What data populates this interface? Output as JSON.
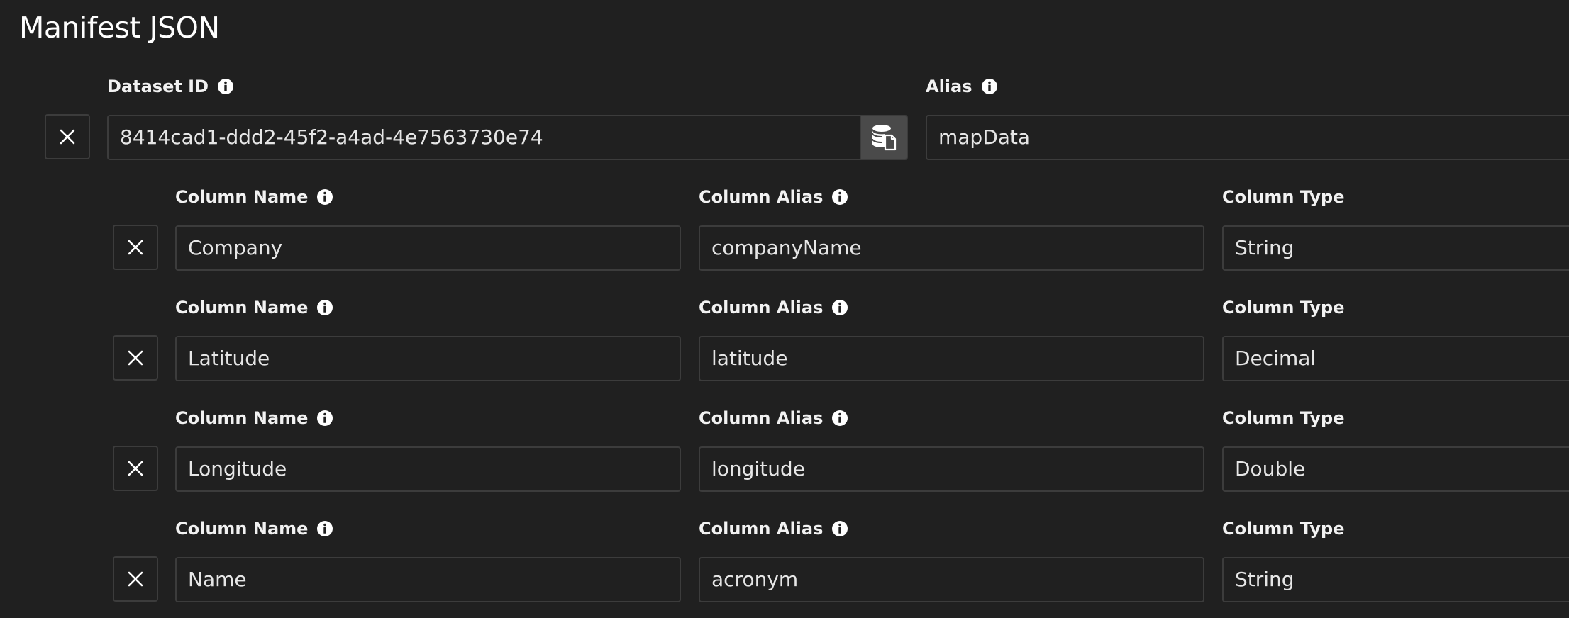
{
  "page": {
    "title": "Manifest JSON"
  },
  "dataset": {
    "id_label": "Dataset ID",
    "id_value": "8414cad1-ddd2-45f2-a4ad-4e7563730e74",
    "alias_label": "Alias",
    "alias_value": "mapData"
  },
  "columns": [
    {
      "name_label": "Column Name",
      "name_value": "Company",
      "alias_label": "Column Alias",
      "alias_value": "companyName",
      "type_label": "Column Type",
      "type_value": "String"
    },
    {
      "name_label": "Column Name",
      "name_value": "Latitude",
      "alias_label": "Column Alias",
      "alias_value": "latitude",
      "type_label": "Column Type",
      "type_value": "Decimal"
    },
    {
      "name_label": "Column Name",
      "name_value": "Longitude",
      "alias_label": "Column Alias",
      "alias_value": "longitude",
      "type_label": "Column Type",
      "type_value": "Double"
    },
    {
      "name_label": "Column Name",
      "name_value": "Name",
      "alias_label": "Column Alias",
      "alias_value": "acronym",
      "type_label": "Column Type",
      "type_value": "String"
    }
  ],
  "icons": {
    "remove": "close-icon",
    "info": "info-icon",
    "dataset_picker": "database-icon"
  },
  "colors": {
    "background": "#202020",
    "border": "#3c3c3c",
    "button_bg": "#4a4a4a",
    "text": "#e6e6e6"
  }
}
